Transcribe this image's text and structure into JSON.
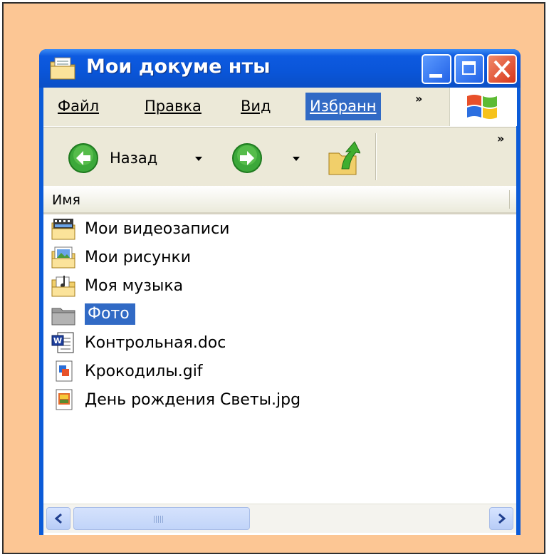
{
  "window": {
    "title": "Мои докуме нты",
    "title_icon": "my-documents-folder-icon",
    "controls": [
      "minimize",
      "maximize",
      "close"
    ]
  },
  "menu": {
    "items": [
      {
        "label": "Файл"
      },
      {
        "label": "Правка"
      },
      {
        "label": "Вид"
      },
      {
        "label": "Избранн",
        "active": true
      }
    ],
    "overflow": "»",
    "logo": "windows-logo-icon"
  },
  "toolbar": {
    "back_label": "Назад",
    "overflow": "»",
    "icons": [
      "back-arrow-icon",
      "forward-arrow-icon",
      "folder-up-icon"
    ]
  },
  "list": {
    "column_header": "Имя",
    "items": [
      {
        "label": "Мои видеозаписи",
        "icon": "video-folder-icon"
      },
      {
        "label": "Мои рисунки",
        "icon": "pictures-folder-icon"
      },
      {
        "label": "Моя музыка",
        "icon": "music-folder-icon"
      },
      {
        "label": "Фото",
        "icon": "folder-icon",
        "selected": true
      },
      {
        "label": "Контрольная.doc",
        "icon": "word-document-icon"
      },
      {
        "label": "Крокодилы.gif",
        "icon": "gif-image-icon"
      },
      {
        "label": "День рождения Светы.jpg",
        "icon": "jpg-image-icon"
      }
    ]
  },
  "colors": {
    "slide_background": "#fcc694",
    "titlebar": "#0a55d8",
    "selection": "#316ac5",
    "chrome": "#ece9d8"
  }
}
